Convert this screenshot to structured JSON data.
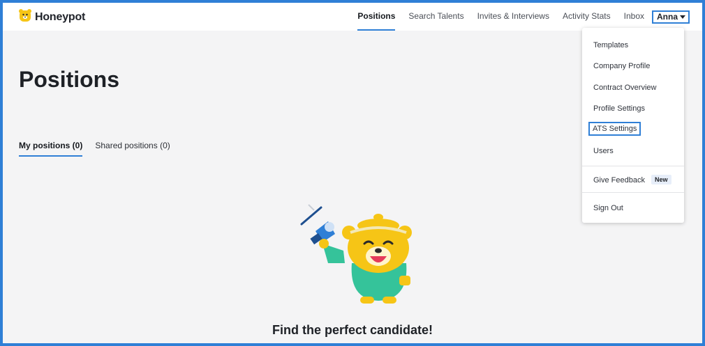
{
  "brand": {
    "name": "Honeypot",
    "accent": "#2f7fd6",
    "logo_color": "#f6c516"
  },
  "nav": {
    "items": [
      "Positions",
      "Search Talents",
      "Invites & Interviews",
      "Activity Stats",
      "Inbox"
    ],
    "active": "Positions",
    "user_label": "Anna"
  },
  "page": {
    "title": "Positions",
    "tabs": [
      "My positions (0)",
      "Shared positions (0)"
    ],
    "cta": "Find the perfect candidate!"
  },
  "dropdown": {
    "items": [
      "Templates",
      "Company Profile",
      "Contract Overview",
      "Profile Settings",
      "ATS Settings",
      "Users"
    ],
    "highlighted": "ATS Settings",
    "feedback_label": "Give Feedback",
    "feedback_badge": "New",
    "sign_out": "Sign Out"
  }
}
